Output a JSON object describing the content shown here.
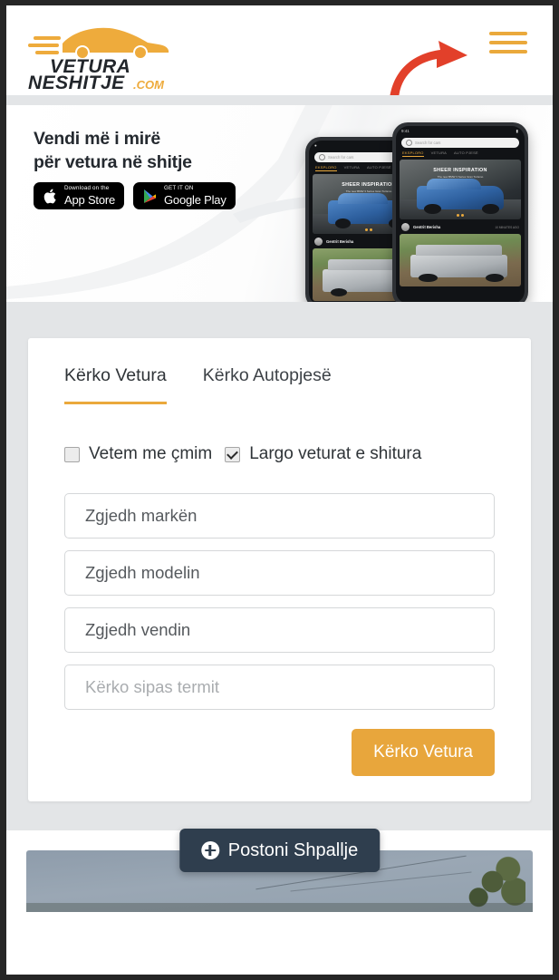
{
  "brand": {
    "logo_line1": "VETURA",
    "logo_line2": "NESHITJE",
    "logo_suffix": ".COM",
    "accent_color": "#eaa93c",
    "arrow_color": "#e2402a"
  },
  "header": {
    "menu_icon": "hamburger-menu-icon"
  },
  "banner": {
    "headline_line1": "Vendi më i mirë",
    "headline_line2": "për vetura në shitje",
    "badges": [
      {
        "small": "Download on the",
        "big": "App Store",
        "icon": "apple-icon"
      },
      {
        "small": "GET IT ON",
        "big": "Google Play",
        "icon": "google-play-icon"
      }
    ],
    "phone_mockup": {
      "status_time": "9:41",
      "status_right": "▮",
      "search_placeholder": "Search for cars",
      "tabs": [
        "EKSPLORO",
        "VETURA",
        "AUTO PJESË"
      ],
      "hero_title": "SHEER INSPIRATION",
      "hero_subtitle": "The new BMW 3 Series Gran Turismo",
      "post_author": "Gentrit Berisha",
      "post_time": "10 MINUTES AGO"
    }
  },
  "search_card": {
    "tabs": [
      {
        "label": "Kërko Vetura",
        "active": true
      },
      {
        "label": "Kërko Autopjesë",
        "active": false
      }
    ],
    "checkboxes": [
      {
        "label": "Vetem me çmim",
        "checked": false
      },
      {
        "label": "Largo veturat e shitura",
        "checked": true
      }
    ],
    "fields": [
      {
        "value": "Zgjedh markën",
        "type": "select"
      },
      {
        "value": "Zgjedh modelin",
        "type": "select"
      },
      {
        "value": "Zgjedh vendin",
        "type": "select"
      },
      {
        "value": "Kërko sipas termit",
        "type": "input",
        "placeholder": "Kërko sipas termit"
      }
    ],
    "submit_label": "Kërko Vetura",
    "submit_color": "#e8a63c"
  },
  "bottom": {
    "post_button_label": "Postoni Shpallje",
    "post_button_icon": "plus-circle-icon",
    "post_button_color": "#2f3e4e"
  }
}
